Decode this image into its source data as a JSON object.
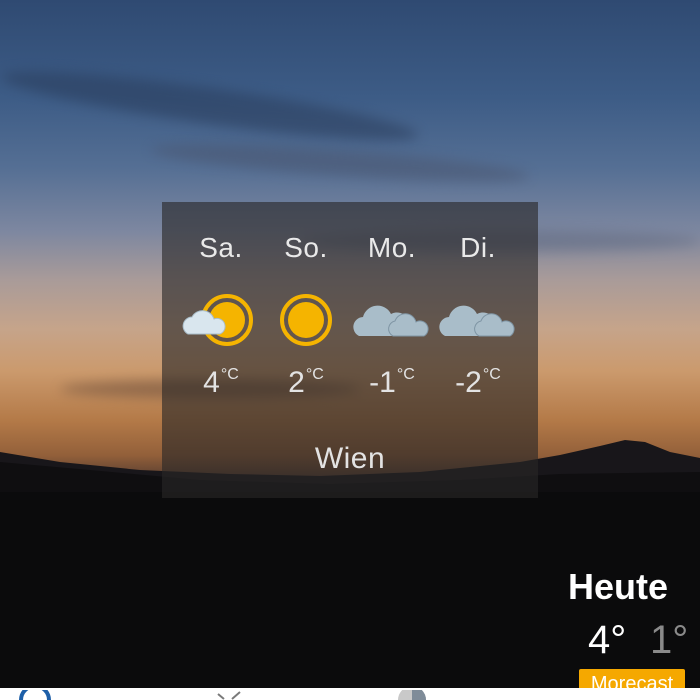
{
  "forecast": {
    "days": [
      {
        "label": "Sa.",
        "temp": "4",
        "unit": "°C",
        "icon": "sun-cloud-icon"
      },
      {
        "label": "So.",
        "temp": "2",
        "unit": "°C",
        "icon": "sun-icon"
      },
      {
        "label": "Mo.",
        "temp": "-1",
        "unit": "°C",
        "icon": "cloud-icon"
      },
      {
        "label": "Di.",
        "temp": "-2",
        "unit": "°C",
        "icon": "cloud-icon"
      }
    ],
    "city": "Wien"
  },
  "today": {
    "title": "Heute",
    "high": "4°",
    "low": "1°"
  },
  "brand_button": {
    "label": "Morecast",
    "color": "#f5a800"
  },
  "colors": {
    "sun": "#f5b400",
    "cloud": "#a9bdc9"
  }
}
